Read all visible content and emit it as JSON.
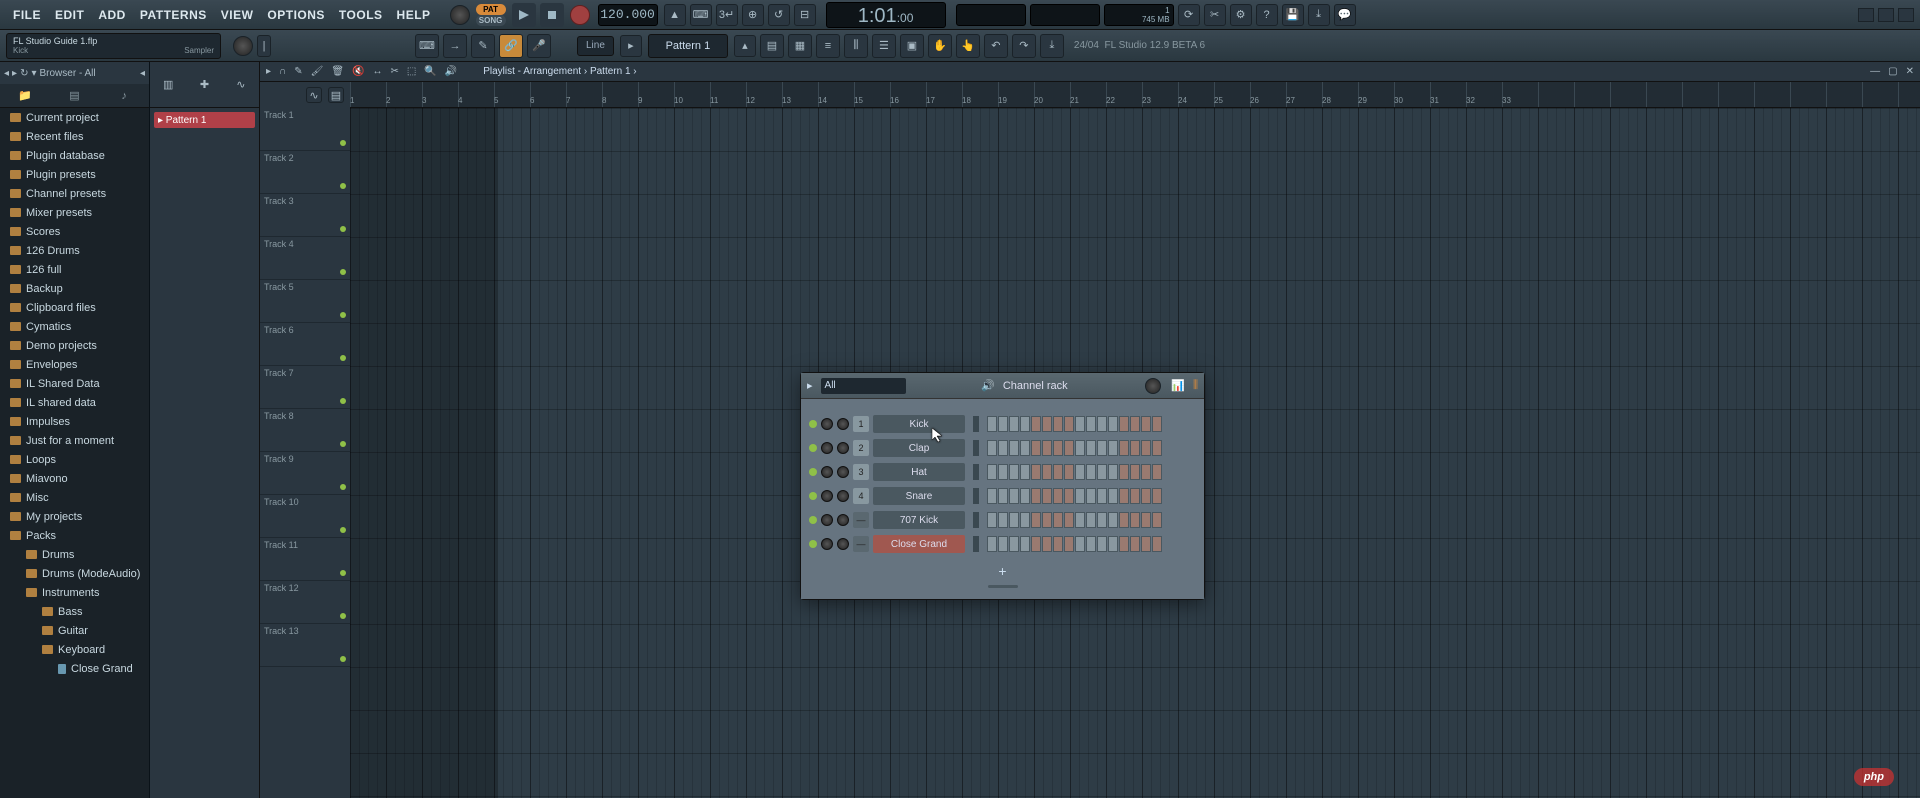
{
  "menus": [
    "FILE",
    "EDIT",
    "ADD",
    "PATTERNS",
    "VIEW",
    "OPTIONS",
    "TOOLS",
    "HELP"
  ],
  "song_pat": {
    "pat": "PAT",
    "song": "SONG"
  },
  "tempo": "120.000",
  "time": {
    "main": "1:01",
    "sub": ":00"
  },
  "cpu": {
    "top": "1",
    "mem": "745 MB"
  },
  "hint": {
    "title": "FL Studio Guide 1.flp",
    "sub": "Kick",
    "tool": "Sampler"
  },
  "pattern_select": "Pattern 1",
  "snap_mode": "Line",
  "version": {
    "date": "24/04",
    "text": "FL Studio 12.9 BETA 6"
  },
  "browser": {
    "header": "Browser - All",
    "items": [
      {
        "label": "Current project",
        "indent": 0,
        "type": "folder"
      },
      {
        "label": "Recent files",
        "indent": 0,
        "type": "folder"
      },
      {
        "label": "Plugin database",
        "indent": 0,
        "type": "folder"
      },
      {
        "label": "Plugin presets",
        "indent": 0,
        "type": "folder"
      },
      {
        "label": "Channel presets",
        "indent": 0,
        "type": "folder"
      },
      {
        "label": "Mixer presets",
        "indent": 0,
        "type": "folder"
      },
      {
        "label": "Scores",
        "indent": 0,
        "type": "folder"
      },
      {
        "label": "126 Drums",
        "indent": 0,
        "type": "folder"
      },
      {
        "label": "126 full",
        "indent": 0,
        "type": "folder"
      },
      {
        "label": "Backup",
        "indent": 0,
        "type": "folder"
      },
      {
        "label": "Clipboard files",
        "indent": 0,
        "type": "folder"
      },
      {
        "label": "Cymatics",
        "indent": 0,
        "type": "folder"
      },
      {
        "label": "Demo projects",
        "indent": 0,
        "type": "folder"
      },
      {
        "label": "Envelopes",
        "indent": 0,
        "type": "folder"
      },
      {
        "label": "IL Shared Data",
        "indent": 0,
        "type": "folder"
      },
      {
        "label": "IL shared data",
        "indent": 0,
        "type": "folder"
      },
      {
        "label": "Impulses",
        "indent": 0,
        "type": "folder"
      },
      {
        "label": "Just for a moment",
        "indent": 0,
        "type": "folder"
      },
      {
        "label": "Loops",
        "indent": 0,
        "type": "folder"
      },
      {
        "label": "Miavono",
        "indent": 0,
        "type": "folder"
      },
      {
        "label": "Misc",
        "indent": 0,
        "type": "folder"
      },
      {
        "label": "My projects",
        "indent": 0,
        "type": "folder"
      },
      {
        "label": "Packs",
        "indent": 0,
        "type": "folder"
      },
      {
        "label": "Drums",
        "indent": 1,
        "type": "folder"
      },
      {
        "label": "Drums (ModeAudio)",
        "indent": 1,
        "type": "folder"
      },
      {
        "label": "Instruments",
        "indent": 1,
        "type": "folder"
      },
      {
        "label": "Bass",
        "indent": 2,
        "type": "folder"
      },
      {
        "label": "Guitar",
        "indent": 2,
        "type": "folder"
      },
      {
        "label": "Keyboard",
        "indent": 2,
        "type": "folder"
      },
      {
        "label": "Close Grand",
        "indent": 3,
        "type": "file"
      }
    ]
  },
  "picker": {
    "items": [
      "Pattern 1"
    ]
  },
  "playlist": {
    "crumb": [
      "Playlist - Arrangement",
      "Pattern 1"
    ],
    "bars": [
      1,
      2,
      3,
      4,
      5,
      6,
      7,
      8,
      9,
      10,
      11,
      12,
      13,
      14,
      15,
      16,
      17,
      18,
      19,
      20,
      21,
      22,
      23,
      24,
      25,
      26,
      27,
      28,
      29,
      30,
      31,
      32,
      33
    ],
    "tracks": [
      "Track 1",
      "Track 2",
      "Track 3",
      "Track 4",
      "Track 5",
      "Track 6",
      "Track 7",
      "Track 8",
      "Track 9",
      "Track 10",
      "Track 11",
      "Track 12",
      "Track 13"
    ]
  },
  "channel_rack": {
    "title": "Channel rack",
    "group": "All",
    "channels": [
      {
        "num": "1",
        "name": "Kick"
      },
      {
        "num": "2",
        "name": "Clap"
      },
      {
        "num": "3",
        "name": "Hat"
      },
      {
        "num": "4",
        "name": "Snare"
      },
      {
        "num": "",
        "name": "707 Kick"
      },
      {
        "num": "",
        "name": "Close Grand",
        "selected": true
      }
    ],
    "add": "+"
  },
  "watermark": "php"
}
